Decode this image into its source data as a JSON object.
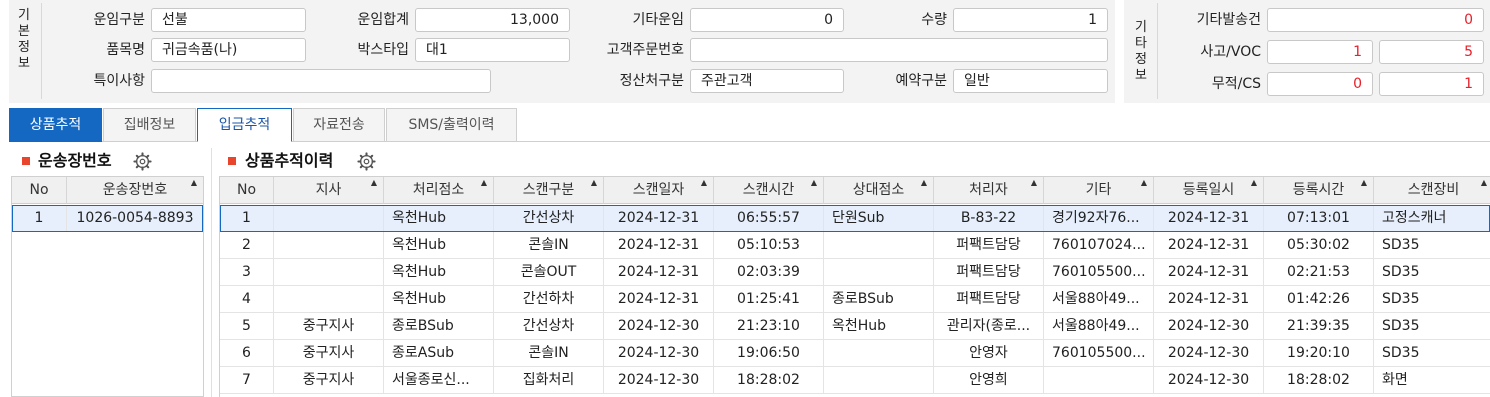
{
  "basic": {
    "side_label": [
      "기",
      "본",
      "정",
      "보"
    ],
    "rate_type_label": "운임구분",
    "rate_type_value": "선불",
    "rate_total_label": "운임합계",
    "rate_total_value": "13,000",
    "other_rate_label": "기타운임",
    "other_rate_value": "0",
    "qty_label": "수량",
    "qty_value": "1",
    "item_label": "품목명",
    "item_value": "귀금속품(나)",
    "box_type_label": "박스타입",
    "box_type_value": "대1",
    "customer_order_label": "고객주문번호",
    "customer_order_value": "",
    "special_label": "특이사항",
    "special_value": "",
    "settle_label": "정산처구분",
    "settle_value": "주관고객",
    "reserve_label": "예약구분",
    "reserve_value": "일반"
  },
  "etc": {
    "side_label": [
      "기",
      "타",
      "정",
      "보"
    ],
    "other_send_label": "기타발송건",
    "other_send_value": "0",
    "accident_label": "사고/VOC",
    "accident_value_1": "1",
    "accident_value_2": "5",
    "nodoc_label": "무적/CS",
    "nodoc_value_1": "0",
    "nodoc_value_2": "1"
  },
  "tabs": [
    "상품추적",
    "집배정보",
    "입금추적",
    "자료전송",
    "SMS/출력이력"
  ],
  "left": {
    "title": "운송장번호",
    "headers": [
      "No",
      "운송장번호"
    ],
    "rows": [
      {
        "no": "1",
        "waybill": "1026-0054-8893"
      }
    ]
  },
  "right": {
    "title": "상품추적이력",
    "headers": [
      "No",
      "지사",
      "처리점소",
      "스캔구분",
      "스캔일자",
      "스캔시간",
      "상대점소",
      "처리자",
      "기타",
      "등록일시",
      "등록시간",
      "스캔장비"
    ],
    "rows": [
      [
        "1",
        "",
        "옥천Hub",
        "간선상차",
        "2024-12-31",
        "06:55:57",
        "단원Sub",
        "B-83-22",
        "경기92자76...",
        "2024-12-31",
        "07:13:01",
        "고정스캐너"
      ],
      [
        "2",
        "",
        "옥천Hub",
        "콘솔IN",
        "2024-12-31",
        "05:10:53",
        "",
        "퍼팩트담당",
        "760107024...",
        "2024-12-31",
        "05:30:02",
        "SD35"
      ],
      [
        "3",
        "",
        "옥천Hub",
        "콘솔OUT",
        "2024-12-31",
        "02:03:39",
        "",
        "퍼팩트담당",
        "760105500...",
        "2024-12-31",
        "02:21:53",
        "SD35"
      ],
      [
        "4",
        "",
        "옥천Hub",
        "간선하차",
        "2024-12-31",
        "01:25:41",
        "종로BSub",
        "퍼팩트담당",
        "서울88아49...",
        "2024-12-31",
        "01:42:26",
        "SD35"
      ],
      [
        "5",
        "중구지사",
        "종로BSub",
        "간선상차",
        "2024-12-30",
        "21:23:10",
        "옥천Hub",
        "관리자(종로...",
        "서울88아49...",
        "2024-12-30",
        "21:39:35",
        "SD35"
      ],
      [
        "6",
        "중구지사",
        "종로ASub",
        "콘솔IN",
        "2024-12-30",
        "19:06:50",
        "",
        "안영자",
        "760105500...",
        "2024-12-30",
        "19:20:10",
        "SD35"
      ],
      [
        "7",
        "중구지사",
        "서울종로신...",
        "집화처리",
        "2024-12-30",
        "18:28:02",
        "",
        "안영희",
        "",
        "2024-12-30",
        "18:28:02",
        "화면"
      ]
    ]
  },
  "colors": {
    "accent": "#1568c2",
    "red_value": "#e8202a",
    "title_square": "#e8452c",
    "selected_row": "#e6effb"
  }
}
